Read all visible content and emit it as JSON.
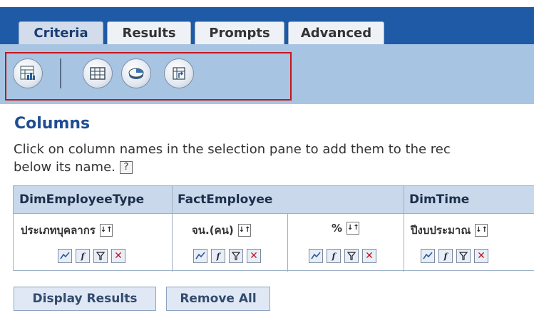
{
  "tabs": [
    {
      "label": "Criteria",
      "active": true
    },
    {
      "label": "Results",
      "active": false
    },
    {
      "label": "Prompts",
      "active": false
    },
    {
      "label": "Advanced",
      "active": false
    }
  ],
  "toolbar": {
    "buttons": [
      {
        "icon": "report-icon"
      },
      {
        "icon": "table-icon"
      },
      {
        "icon": "chart-icon"
      },
      {
        "icon": "pivot-icon"
      }
    ],
    "highlight_color": "#c4161c"
  },
  "section": {
    "title": "Columns",
    "description_line1": "Click on column names in the selection pane to add them to the rec",
    "description_line2": "below its name.",
    "help_glyph": "?"
  },
  "column_groups": [
    {
      "label": "DimEmployeeType"
    },
    {
      "label": "FactEmployee"
    },
    {
      "label": "DimTime"
    }
  ],
  "columns": [
    {
      "name": "ประเภทบุคลากร"
    },
    {
      "name": "จน.(คน)"
    },
    {
      "name": "%"
    },
    {
      "name": "ปีงบประมาณ"
    }
  ],
  "column_icons": {
    "format": "format-icon",
    "formula": "f",
    "filter": "filter-icon",
    "delete": "✕"
  },
  "actions": {
    "display_results": "Display Results",
    "remove_all": "Remove All"
  },
  "colors": {
    "tab_bar": "#1e5aa6",
    "toolbar": "#a7c5e3",
    "title": "#1f4e92",
    "header": "#c9d8ea"
  }
}
